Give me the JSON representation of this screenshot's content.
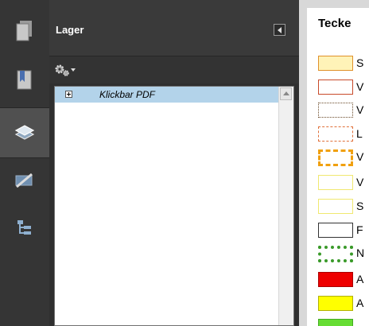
{
  "panel": {
    "title": "Lager"
  },
  "layers": [
    {
      "label": "Klickbar PDF",
      "expanded": false,
      "selected": true
    }
  ],
  "rail_icons": [
    "pages-icon",
    "bookmarks-icon",
    "layers-icon",
    "signatures-icon",
    "structure-icon"
  ],
  "legend": {
    "title": "Tecke",
    "items": [
      {
        "text": "S",
        "style": "solid-orange-on-yellow"
      },
      {
        "text": "V",
        "style": "solid-red"
      },
      {
        "text": "V",
        "style": "dotted-brown"
      },
      {
        "text": "L",
        "style": "dashed-orange"
      },
      {
        "text": "V",
        "style": "thick-dashed-orange"
      },
      {
        "text": "V",
        "style": "solid-yellow"
      },
      {
        "text": "S",
        "style": "solid-yellow"
      },
      {
        "text": "F",
        "style": "solid-black"
      },
      {
        "text": "N",
        "style": "thick-dotted-green"
      },
      {
        "text": "A",
        "style": "fill-red"
      },
      {
        "text": "A",
        "style": "fill-yellow"
      },
      {
        "text": "",
        "style": "fill-green"
      }
    ]
  },
  "colors": {
    "rail": "#353535",
    "panel": "#2f2f2f",
    "selection": "#b3d3ea"
  }
}
